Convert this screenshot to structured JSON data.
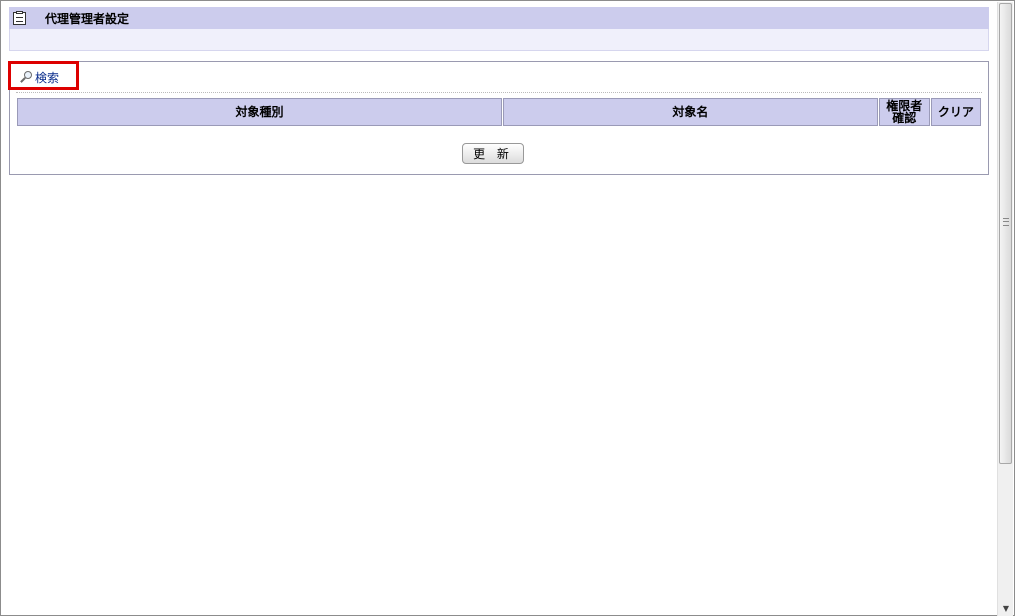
{
  "header": {
    "title": "代理管理者設定",
    "icon": "clipboard-icon"
  },
  "search": {
    "label": "検索",
    "icon": "magnifier-icon",
    "highlight_color": "#dd0000"
  },
  "table": {
    "columns": [
      "対象種別",
      "対象名",
      "権限者確認",
      "クリア"
    ],
    "column_lines": {
      "authority_check": [
        "権限者",
        "確認"
      ]
    }
  },
  "actions": {
    "update_label": "更 新"
  },
  "colors": {
    "header_bg": "#cccced",
    "link": "#0b2d8c"
  }
}
